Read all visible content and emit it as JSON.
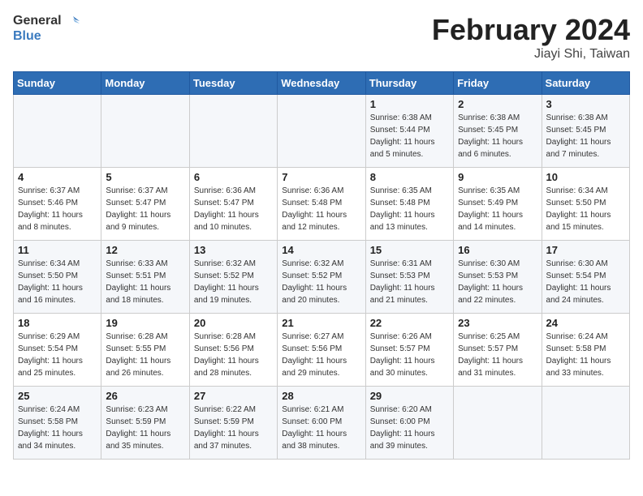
{
  "header": {
    "logo_text_general": "General",
    "logo_text_blue": "Blue",
    "month_year": "February 2024",
    "location": "Jiayi Shi, Taiwan"
  },
  "weekdays": [
    "Sunday",
    "Monday",
    "Tuesday",
    "Wednesday",
    "Thursday",
    "Friday",
    "Saturday"
  ],
  "weeks": [
    [
      {
        "day": "",
        "info": ""
      },
      {
        "day": "",
        "info": ""
      },
      {
        "day": "",
        "info": ""
      },
      {
        "day": "",
        "info": ""
      },
      {
        "day": "1",
        "info": "Sunrise: 6:38 AM\nSunset: 5:44 PM\nDaylight: 11 hours\nand 5 minutes."
      },
      {
        "day": "2",
        "info": "Sunrise: 6:38 AM\nSunset: 5:45 PM\nDaylight: 11 hours\nand 6 minutes."
      },
      {
        "day": "3",
        "info": "Sunrise: 6:38 AM\nSunset: 5:45 PM\nDaylight: 11 hours\nand 7 minutes."
      }
    ],
    [
      {
        "day": "4",
        "info": "Sunrise: 6:37 AM\nSunset: 5:46 PM\nDaylight: 11 hours\nand 8 minutes."
      },
      {
        "day": "5",
        "info": "Sunrise: 6:37 AM\nSunset: 5:47 PM\nDaylight: 11 hours\nand 9 minutes."
      },
      {
        "day": "6",
        "info": "Sunrise: 6:36 AM\nSunset: 5:47 PM\nDaylight: 11 hours\nand 10 minutes."
      },
      {
        "day": "7",
        "info": "Sunrise: 6:36 AM\nSunset: 5:48 PM\nDaylight: 11 hours\nand 12 minutes."
      },
      {
        "day": "8",
        "info": "Sunrise: 6:35 AM\nSunset: 5:48 PM\nDaylight: 11 hours\nand 13 minutes."
      },
      {
        "day": "9",
        "info": "Sunrise: 6:35 AM\nSunset: 5:49 PM\nDaylight: 11 hours\nand 14 minutes."
      },
      {
        "day": "10",
        "info": "Sunrise: 6:34 AM\nSunset: 5:50 PM\nDaylight: 11 hours\nand 15 minutes."
      }
    ],
    [
      {
        "day": "11",
        "info": "Sunrise: 6:34 AM\nSunset: 5:50 PM\nDaylight: 11 hours\nand 16 minutes."
      },
      {
        "day": "12",
        "info": "Sunrise: 6:33 AM\nSunset: 5:51 PM\nDaylight: 11 hours\nand 18 minutes."
      },
      {
        "day": "13",
        "info": "Sunrise: 6:32 AM\nSunset: 5:52 PM\nDaylight: 11 hours\nand 19 minutes."
      },
      {
        "day": "14",
        "info": "Sunrise: 6:32 AM\nSunset: 5:52 PM\nDaylight: 11 hours\nand 20 minutes."
      },
      {
        "day": "15",
        "info": "Sunrise: 6:31 AM\nSunset: 5:53 PM\nDaylight: 11 hours\nand 21 minutes."
      },
      {
        "day": "16",
        "info": "Sunrise: 6:30 AM\nSunset: 5:53 PM\nDaylight: 11 hours\nand 22 minutes."
      },
      {
        "day": "17",
        "info": "Sunrise: 6:30 AM\nSunset: 5:54 PM\nDaylight: 11 hours\nand 24 minutes."
      }
    ],
    [
      {
        "day": "18",
        "info": "Sunrise: 6:29 AM\nSunset: 5:54 PM\nDaylight: 11 hours\nand 25 minutes."
      },
      {
        "day": "19",
        "info": "Sunrise: 6:28 AM\nSunset: 5:55 PM\nDaylight: 11 hours\nand 26 minutes."
      },
      {
        "day": "20",
        "info": "Sunrise: 6:28 AM\nSunset: 5:56 PM\nDaylight: 11 hours\nand 28 minutes."
      },
      {
        "day": "21",
        "info": "Sunrise: 6:27 AM\nSunset: 5:56 PM\nDaylight: 11 hours\nand 29 minutes."
      },
      {
        "day": "22",
        "info": "Sunrise: 6:26 AM\nSunset: 5:57 PM\nDaylight: 11 hours\nand 30 minutes."
      },
      {
        "day": "23",
        "info": "Sunrise: 6:25 AM\nSunset: 5:57 PM\nDaylight: 11 hours\nand 31 minutes."
      },
      {
        "day": "24",
        "info": "Sunrise: 6:24 AM\nSunset: 5:58 PM\nDaylight: 11 hours\nand 33 minutes."
      }
    ],
    [
      {
        "day": "25",
        "info": "Sunrise: 6:24 AM\nSunset: 5:58 PM\nDaylight: 11 hours\nand 34 minutes."
      },
      {
        "day": "26",
        "info": "Sunrise: 6:23 AM\nSunset: 5:59 PM\nDaylight: 11 hours\nand 35 minutes."
      },
      {
        "day": "27",
        "info": "Sunrise: 6:22 AM\nSunset: 5:59 PM\nDaylight: 11 hours\nand 37 minutes."
      },
      {
        "day": "28",
        "info": "Sunrise: 6:21 AM\nSunset: 6:00 PM\nDaylight: 11 hours\nand 38 minutes."
      },
      {
        "day": "29",
        "info": "Sunrise: 6:20 AM\nSunset: 6:00 PM\nDaylight: 11 hours\nand 39 minutes."
      },
      {
        "day": "",
        "info": ""
      },
      {
        "day": "",
        "info": ""
      }
    ]
  ]
}
